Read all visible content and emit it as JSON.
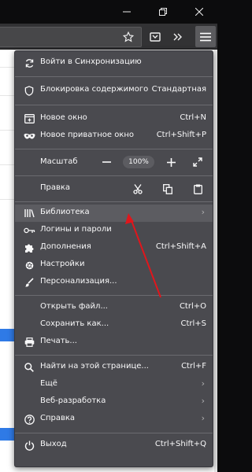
{
  "window": {
    "minimize_icon": "minimize-icon",
    "maximize_icon": "restore-icon",
    "close_icon": "close-icon"
  },
  "toolbar": {
    "star_icon": "bookmark-star-icon",
    "pocket_icon": "pocket-icon",
    "overflow_icon": "chevron-double-right-icon",
    "menu_icon": "hamburger-menu-icon"
  },
  "menu": {
    "sync": "Войти в Синхронизацию",
    "content_blocking": {
      "label": "Блокировка содержимого",
      "value": "Стандартная"
    },
    "new_window": {
      "label": "Новое окно",
      "shortcut": "Ctrl+N"
    },
    "new_private": {
      "label": "Новое приватное окно",
      "shortcut": "Ctrl+Shift+P"
    },
    "zoom": {
      "label": "Масштаб",
      "minus": "—",
      "value": "100%",
      "plus": "+"
    },
    "edit": {
      "label": "Правка"
    },
    "library": "Библиотека",
    "logins": "Логины и пароли",
    "addons": {
      "label": "Дополнения",
      "shortcut": "Ctrl+Shift+A"
    },
    "settings": "Настройки",
    "customize": "Персонализация...",
    "open_file": {
      "label": "Открыть файл...",
      "shortcut": "Ctrl+O"
    },
    "save_as": {
      "label": "Сохранить как...",
      "shortcut": "Ctrl+S"
    },
    "print": "Печать...",
    "find": {
      "label": "Найти на этой странице...",
      "shortcut": "Ctrl+F"
    },
    "more": "Ещё",
    "webdev": "Веб-разработка",
    "help": "Справка",
    "exit": {
      "label": "Выход",
      "shortcut": "Ctrl+Shift+Q"
    }
  },
  "colors": {
    "menu_bg": "#4a4a4f",
    "highlight": "#5c5c61",
    "annotation_arrow": "#e0161c"
  }
}
